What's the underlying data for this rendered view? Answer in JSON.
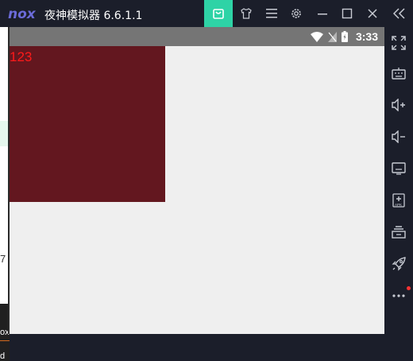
{
  "titlebar": {
    "logo_text": "nox",
    "title": "夜神模拟器 6.6.1.1",
    "buttons": [
      "store-icon",
      "shirt-icon",
      "menu-icon",
      "gear-icon",
      "minimize-icon",
      "maximize-icon",
      "close-icon",
      "collapse-icon"
    ]
  },
  "statusbar": {
    "time": "3:33",
    "icons": [
      "wifi-icon",
      "no-sim-icon",
      "battery-icon"
    ]
  },
  "screen": {
    "box_label": "123",
    "box_color": "#63171f",
    "label_color": "#ff1a1a"
  },
  "sidebar": {
    "items": [
      "fullscreen-icon",
      "keyboard-icon",
      "volume-up-icon",
      "volume-down-icon",
      "screen-icon",
      "apk-install-icon",
      "multi-instance-icon",
      "rocket-icon",
      "more-icon"
    ]
  },
  "left_strip": {
    "symbol": "7",
    "text1": "ox",
    "text2": "d"
  },
  "colors": {
    "accent": "#2ed3a6",
    "frame": "#1b1e2a",
    "logo": "#6b6bd8"
  }
}
